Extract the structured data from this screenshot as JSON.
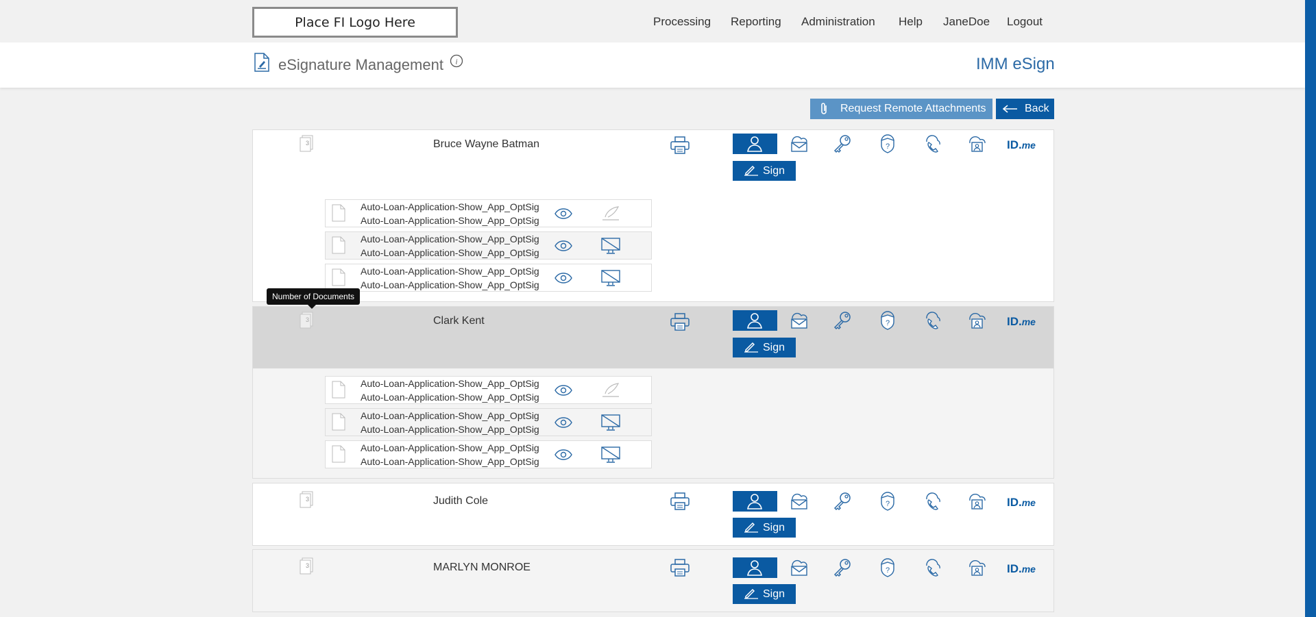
{
  "logo": {
    "text": "Place FI Logo Here"
  },
  "nav": {
    "items": [
      "Processing",
      "Reporting",
      "Administration",
      "Help",
      "JaneDoe",
      "Logout"
    ]
  },
  "header": {
    "title": "eSignature Management",
    "app_name": "IMM eSign"
  },
  "actions": {
    "remote_label": "Request Remote Attachments",
    "back_label": "Back"
  },
  "signers": [
    {
      "name": "Bruce Wayne Batman",
      "doc_count": "3",
      "sign_label": "Sign"
    },
    {
      "name": "Clark Kent",
      "doc_count": "3",
      "sign_label": "Sign"
    },
    {
      "name": "Judith Cole",
      "doc_count": "3",
      "sign_label": "Sign"
    },
    {
      "name": "MARLYN MONROE",
      "doc_count": "3",
      "sign_label": "Sign"
    }
  ],
  "documents": {
    "line1": "Auto-Loan-Application-Show_App_OptSig",
    "line2": "Auto-Loan-Application-Show_App_OptSig"
  },
  "idme": {
    "brand": "ID.",
    "suffix": "me"
  },
  "tooltip": {
    "text": "Number of Documents"
  },
  "colors": {
    "primary": "#0a5aa2",
    "secondary": "#5b94c6",
    "icon": "#2c6aa6",
    "selected_row": "#d6d6d6"
  }
}
